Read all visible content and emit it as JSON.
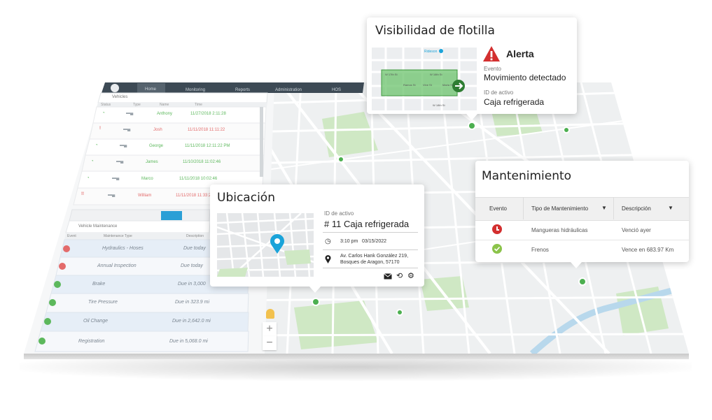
{
  "app": {
    "nav": [
      "Home",
      "Monitoring",
      "Reports",
      "Administration",
      "HOS"
    ],
    "vehicles_title": "Vehicles",
    "vehicles_filters": [
      "Status",
      "Type",
      "Name",
      "Time"
    ],
    "vehicles": [
      {
        "driver": "Anthony",
        "time": "11/27/2018 2:11:28",
        "color": "#5cb85c"
      },
      {
        "driver": "Josh",
        "time": "11/11/2018 11:11:22",
        "color": "#e36b6b"
      },
      {
        "driver": "George",
        "time": "11/11/2018 12:11:22 PM",
        "color": "#5cb85c"
      },
      {
        "driver": "James",
        "time": "11/10/2018 11:02:46",
        "color": "#5cb85c"
      },
      {
        "driver": "Marco",
        "time": "11/11/2018 10:02:46",
        "color": "#5cb85c"
      },
      {
        "driver": "William",
        "time": "11/11/2018 11:33:20",
        "color": "#e36b6b"
      }
    ],
    "maintenance_title": "Vehicle Maintenance",
    "maintenance_cols": [
      "Event",
      "Maintenance Type",
      "Description"
    ],
    "maintenance": [
      {
        "type": "Hydraulics - Hoses",
        "due": "Due today",
        "status": "red"
      },
      {
        "type": "Annual Inspection",
        "due": "Due today",
        "status": "red"
      },
      {
        "type": "Brake",
        "due": "Due in 3,000",
        "status": "green"
      },
      {
        "type": "Tire Pressure",
        "due": "Due in 323.9 mi",
        "status": "green"
      },
      {
        "type": "Oil Change",
        "due": "Due in 2,642.0 mi",
        "status": "green"
      },
      {
        "type": "Registration",
        "due": "Due in 5,068.0 mi",
        "status": "green"
      }
    ]
  },
  "fleet_card": {
    "title": "Visibilidad de flotilla",
    "alert_label": "Alerta",
    "event_label": "Evento",
    "event_value": "Movimiento detectado",
    "asset_label": "ID de activo",
    "asset_value": "Caja refrigerada",
    "mini_map_poi": "Rideson",
    "mini_map_streets": [
      "W 17th St",
      "W 16th St",
      "Ramos St",
      "Vine St",
      "Maria St",
      "W 18th St"
    ]
  },
  "location_card": {
    "title": "Ubicación",
    "asset_label": "ID de activo",
    "asset_value": "# 11 Caja refrigerada",
    "time": "3:10 pm",
    "date": "03/15/2022",
    "address_line1": "Av. Carlos Hank González 219,",
    "address_line2": "Bosques de Aragon, 57170"
  },
  "maint_card": {
    "title": "Mantenimiento",
    "col_event": "Evento",
    "col_type": "Tipo de Mantenimiento",
    "col_desc": "Descripción",
    "rows": [
      {
        "type": "Mangueras hidráulicas",
        "desc": "Venció ayer",
        "status": "red"
      },
      {
        "type": "Frenos",
        "desc": "Vence en 683.97 Km",
        "status": "green"
      }
    ]
  },
  "colors": {
    "alert_red": "#d32f2f",
    "ok_green": "#8bc34a",
    "pin_blue": "#1aa3d9",
    "geofence_green": "#5cb85c",
    "nav_bar": "#3d4a55"
  }
}
